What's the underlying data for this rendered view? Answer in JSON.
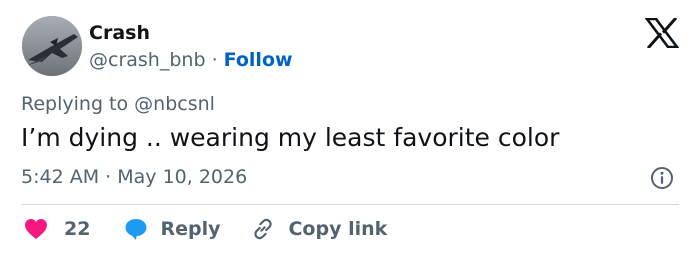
{
  "author": {
    "name": "Crash",
    "handle": "@crash_bnb",
    "separator": "·",
    "follow_label": "Follow"
  },
  "brand": {
    "logo_icon": "x-logo-icon"
  },
  "reply_context": {
    "prefix": "Replying to",
    "mention": "@nbcsnl"
  },
  "tweet": {
    "text": "I’m dying .. wearing my least favorite color",
    "time": "5:42 AM",
    "date_separator": "·",
    "date": "May 10, 2026"
  },
  "actions": {
    "like_count": "22",
    "reply_label": "Reply",
    "copy_link_label": "Copy link"
  },
  "colors": {
    "text": "#0f1419",
    "secondary": "#536471",
    "follow": "#0062c4",
    "like": "#f91880",
    "reply": "#1d9bf0",
    "divider": "#cfd9de"
  }
}
